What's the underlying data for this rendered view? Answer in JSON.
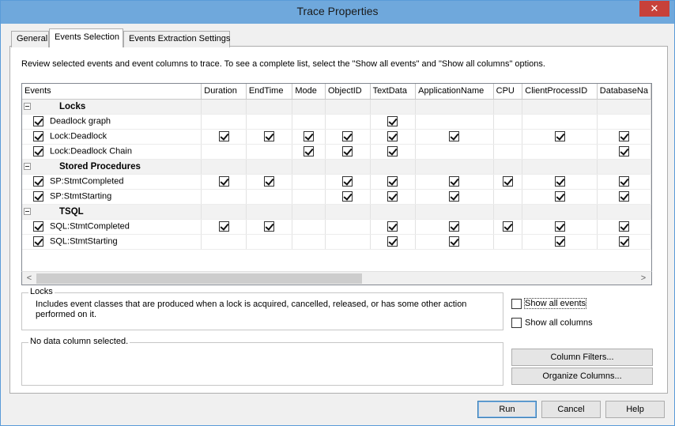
{
  "window": {
    "title": "Trace Properties",
    "close_glyph": "✕"
  },
  "tabs": [
    {
      "label": "General"
    },
    {
      "label": "Events Selection"
    },
    {
      "label": "Events Extraction Settings"
    }
  ],
  "instructions": "Review selected events and event columns to trace. To see a complete list, select the \"Show all events\" and \"Show all columns\" options.",
  "grid": {
    "columns": [
      "Events",
      "Duration",
      "EndTime",
      "Mode",
      "ObjectID",
      "TextData",
      "ApplicationName",
      "CPU",
      "ClientProcessID",
      "DatabaseNa"
    ],
    "categories": [
      {
        "name": "Locks",
        "events": [
          {
            "name": "Deadlock graph",
            "checked": true,
            "cols": [
              false,
              false,
              false,
              false,
              true,
              false,
              false,
              false,
              false
            ]
          },
          {
            "name": "Lock:Deadlock",
            "checked": true,
            "cols": [
              true,
              true,
              true,
              true,
              true,
              true,
              false,
              true,
              true
            ]
          },
          {
            "name": "Lock:Deadlock Chain",
            "checked": true,
            "cols": [
              false,
              false,
              true,
              true,
              true,
              false,
              false,
              false,
              true
            ]
          }
        ]
      },
      {
        "name": "Stored Procedures",
        "events": [
          {
            "name": "SP:StmtCompleted",
            "checked": true,
            "cols": [
              true,
              true,
              false,
              true,
              true,
              true,
              true,
              true,
              true
            ]
          },
          {
            "name": "SP:StmtStarting",
            "checked": true,
            "cols": [
              false,
              false,
              false,
              true,
              true,
              true,
              false,
              true,
              true
            ]
          }
        ]
      },
      {
        "name": "TSQL",
        "events": [
          {
            "name": "SQL:StmtCompleted",
            "checked": true,
            "cols": [
              true,
              true,
              false,
              false,
              true,
              true,
              true,
              true,
              true
            ]
          },
          {
            "name": "SQL:StmtStarting",
            "checked": true,
            "cols": [
              false,
              false,
              false,
              false,
              true,
              true,
              false,
              true,
              true
            ]
          }
        ]
      }
    ],
    "scroll_left_glyph": "<",
    "scroll_right_glyph": ">"
  },
  "description_box": {
    "legend": "Locks",
    "text": "Includes event classes that are produced when a lock is acquired, cancelled, released, or has some other action performed on it."
  },
  "column_box": {
    "legend": "No data column selected."
  },
  "options": {
    "show_all_events": {
      "label": "Show all events",
      "checked": false
    },
    "show_all_columns": {
      "label": "Show all columns",
      "checked": false
    }
  },
  "buttons": {
    "column_filters": "Column Filters...",
    "organize_columns": "Organize Columns...",
    "run": "Run",
    "cancel": "Cancel",
    "help": "Help"
  }
}
